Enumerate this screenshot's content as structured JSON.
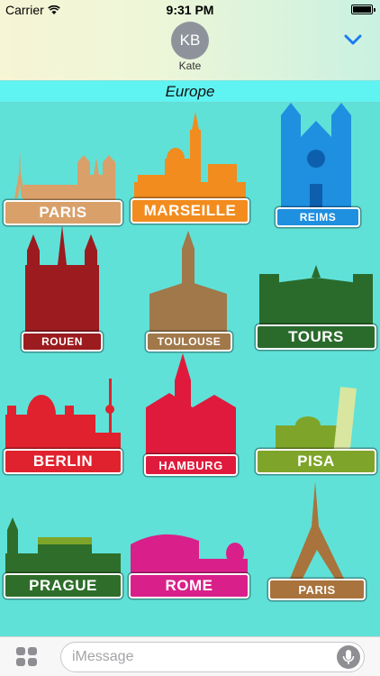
{
  "status_bar": {
    "carrier": "Carrier",
    "time": "9:31 PM"
  },
  "header": {
    "avatar_initials": "KB",
    "contact_name": "Kate"
  },
  "section": {
    "title": "Europe"
  },
  "stickers": [
    {
      "label": "PARIS",
      "color": "#d9a06a"
    },
    {
      "label": "MARSEILLE",
      "color": "#f28c1e"
    },
    {
      "label": "REIMS",
      "color": "#1f8fe0"
    },
    {
      "label": "ROUEN",
      "color": "#9b1b1f"
    },
    {
      "label": "TOULOUSE",
      "color": "#a0784a"
    },
    {
      "label": "TOURS",
      "color": "#2a6b2c"
    },
    {
      "label": "BERLIN",
      "color": "#e0222e"
    },
    {
      "label": "HAMBURG",
      "color": "#e01a3c"
    },
    {
      "label": "PISA",
      "color": "#7ea52a"
    },
    {
      "label": "PRAGUE",
      "color": "#2e6e2a"
    },
    {
      "label": "ROME",
      "color": "#d9208a"
    },
    {
      "label": "PARIS",
      "color": "#a8733c"
    }
  ],
  "composer": {
    "placeholder": "iMessage"
  }
}
